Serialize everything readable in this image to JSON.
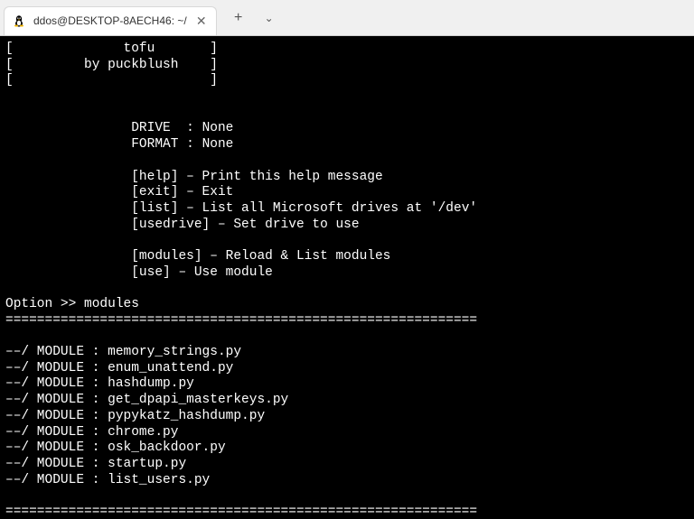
{
  "window": {
    "tab_title": "ddos@DESKTOP-8AECH46: ~/"
  },
  "banner": {
    "line1": "[              tofu       ]",
    "line2": "[         by puckblush    ]",
    "line3": "[                         ]"
  },
  "status": {
    "drive_label": "DRIVE  : ",
    "drive_value": "None",
    "format_label": "FORMAT : ",
    "format_value": "None"
  },
  "commands": {
    "help": "[help] – Print this help message",
    "exit": "[exit] – Exit",
    "list": "[list] – List all Microsoft drives at '/dev'",
    "usedrive": "[usedrive] – Set drive to use",
    "modules": "[modules] – Reload & List modules",
    "use": "[use] – Use module"
  },
  "prompt": {
    "label": "Option >> ",
    "input": "modules"
  },
  "dividers": {
    "top": "============================================================",
    "bottom": "============================================================"
  },
  "modules": {
    "prefix": "––/ MODULE : ",
    "items": [
      "memory_strings.py",
      "enum_unattend.py",
      "hashdump.py",
      "get_dpapi_masterkeys.py",
      "pypykatz_hashdump.py",
      "chrome.py",
      "osk_backdoor.py",
      "startup.py",
      "list_users.py"
    ]
  },
  "indent": {
    "status": "                ",
    "command": "                "
  }
}
